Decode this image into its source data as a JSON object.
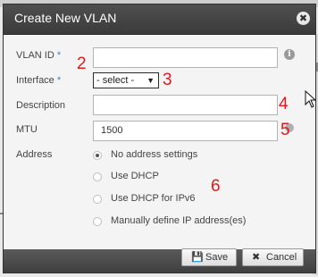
{
  "dialog": {
    "title": "Create New VLAN",
    "close_glyph": "✖"
  },
  "form": {
    "vlan_id": {
      "label": "VLAN ID",
      "required_mark": "*",
      "value": ""
    },
    "interface": {
      "label": "Interface",
      "required_mark": "*",
      "selected": "- select -"
    },
    "description": {
      "label": "Description",
      "value": ""
    },
    "mtu": {
      "label": "MTU",
      "value": "1500"
    },
    "address": {
      "label": "Address",
      "options": [
        {
          "label": "No address settings",
          "checked": true
        },
        {
          "label": "Use DHCP",
          "checked": false
        },
        {
          "label": "Use DHCP for IPv6",
          "checked": false
        },
        {
          "label": "Manually define IP address(es)",
          "checked": false
        }
      ]
    }
  },
  "annotations": [
    "2",
    "3",
    "4",
    "5",
    "6"
  ],
  "buttons": {
    "save": "Save",
    "cancel": "Cancel"
  },
  "icons": {
    "info": "info-icon",
    "save": "floppy-disk-icon",
    "cancel": "x-icon",
    "close": "close-icon"
  },
  "colors": {
    "titlebar": "#444444",
    "required_mark": "#3a87c8",
    "annotation": "#e01a1a"
  }
}
